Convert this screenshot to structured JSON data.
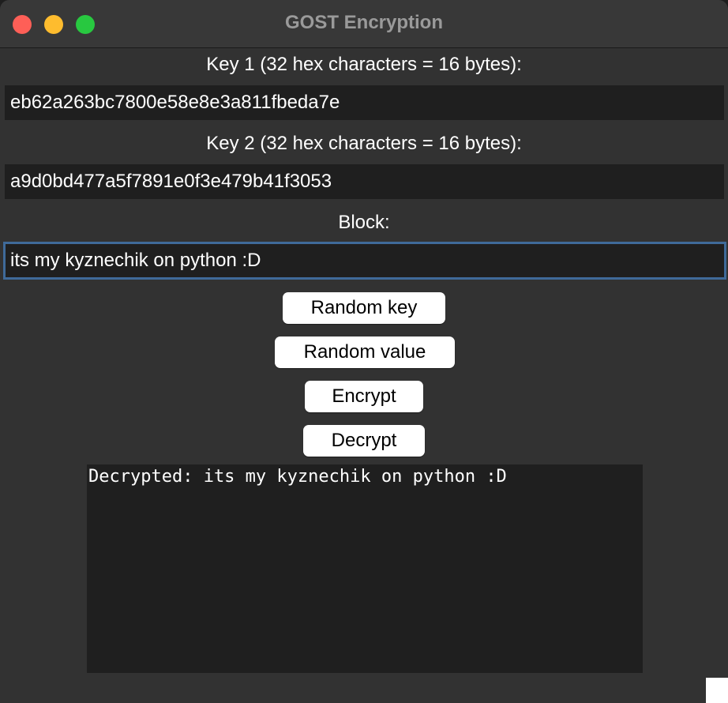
{
  "window": {
    "title": "GOST Encryption"
  },
  "key1": {
    "label": "Key 1 (32 hex characters = 16 bytes):",
    "value": "eb62a263bc7800e58e8e3a811fbeda7e"
  },
  "key2": {
    "label": "Key 2 (32 hex characters = 16 bytes):",
    "value": "a9d0bd477a5f7891e0f3e479b41f3053"
  },
  "block": {
    "label": "Block:",
    "value": "its my kyznechik on python :D"
  },
  "buttons": {
    "random_key": "Random key",
    "random_value": "Random value",
    "encrypt": "Encrypt",
    "decrypt": "Decrypt"
  },
  "output": {
    "text": "Decrypted: its my kyznechik on python :D"
  },
  "colors": {
    "window_bg": "#323232",
    "field_bg": "#1f1f1f",
    "focus_ring": "#3f6a99",
    "close": "#fe5f57",
    "minimize": "#febc2e",
    "zoom": "#28c840"
  }
}
